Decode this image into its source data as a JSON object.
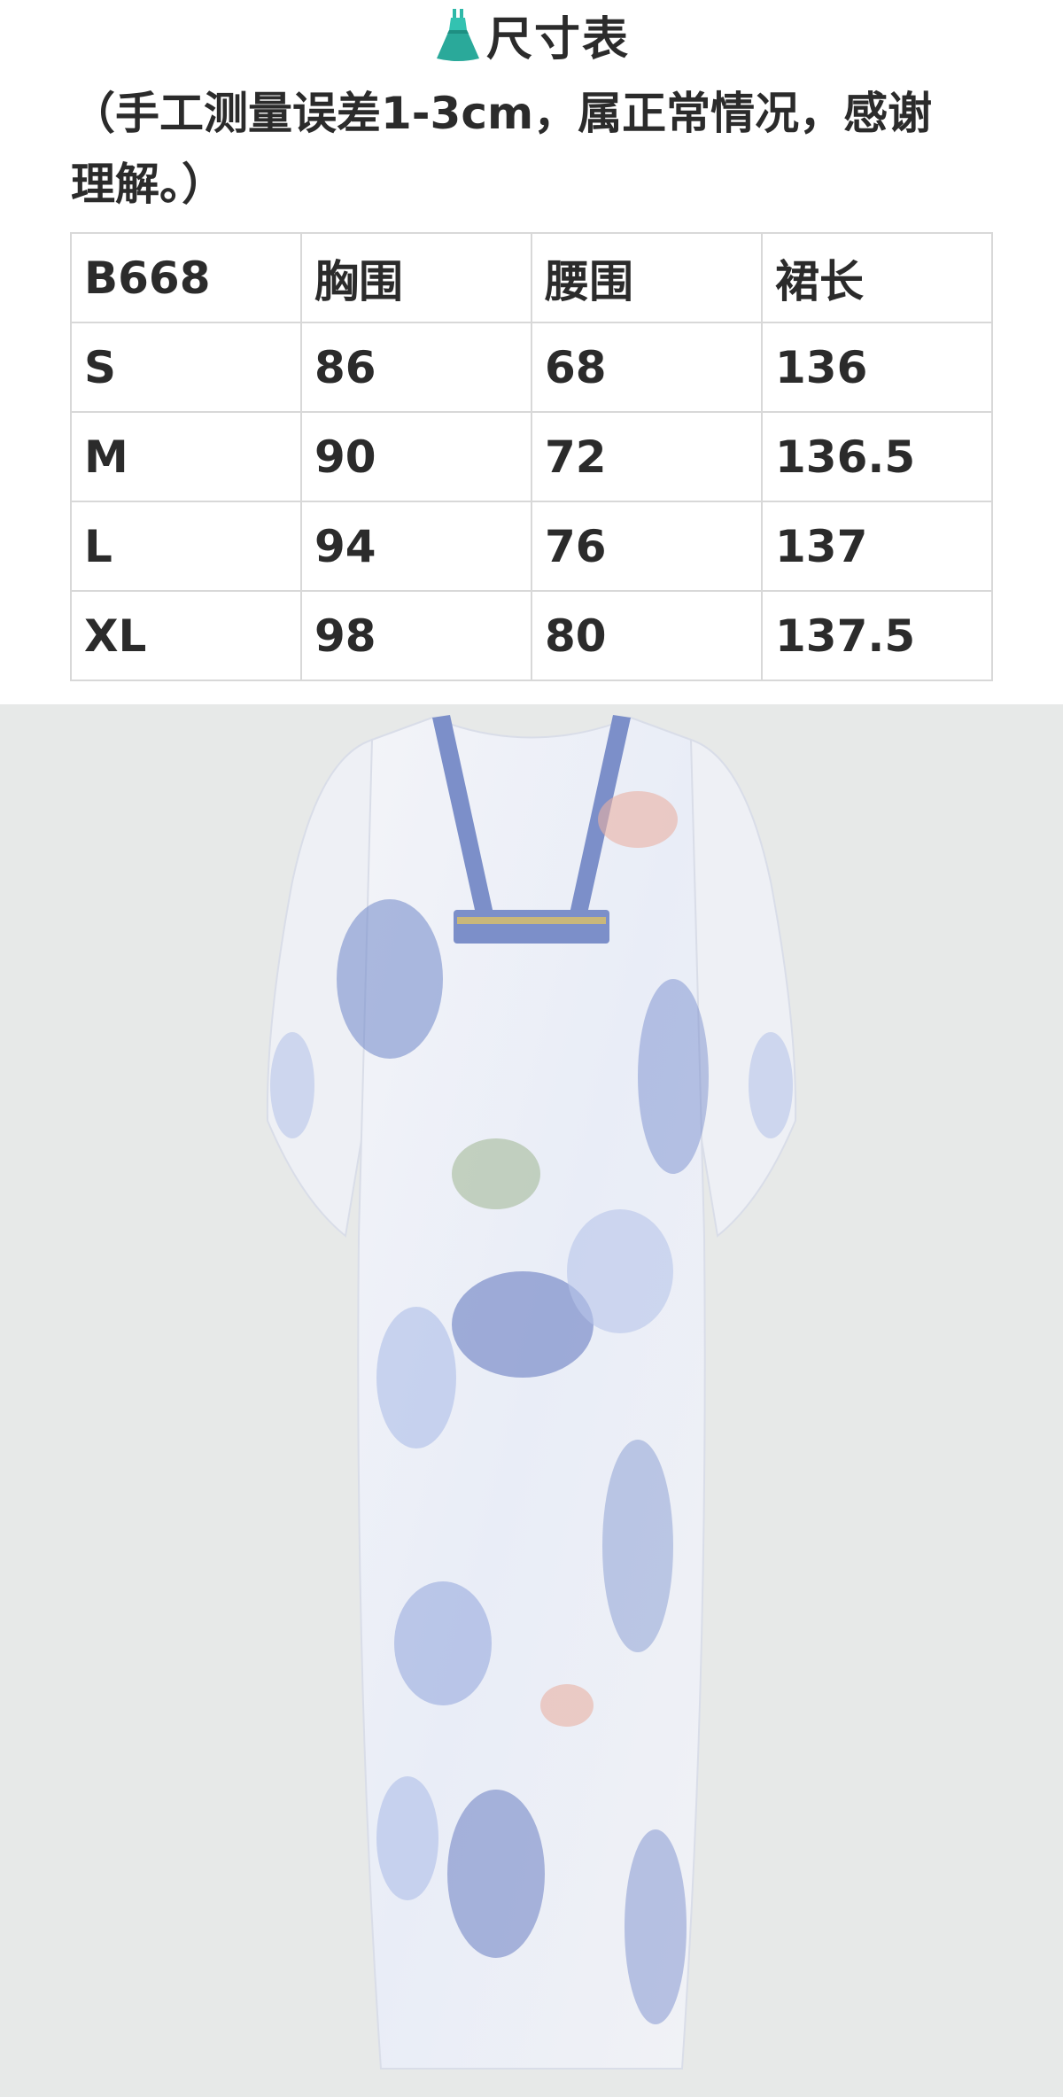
{
  "header": {
    "icon": "dress-icon",
    "title": "尺寸表"
  },
  "note": "（手工测量误差1-3cm，属正常情况，感谢理解。）",
  "size_table": {
    "headers": [
      "B668",
      "胸围",
      "腰围",
      "裙长"
    ],
    "rows": [
      [
        "S",
        "86",
        "68",
        "136"
      ],
      [
        "M",
        "90",
        "72",
        "136.5"
      ],
      [
        "L",
        "94",
        "76",
        "137"
      ],
      [
        "XL",
        "98",
        "80",
        "137.5"
      ]
    ]
  },
  "product_image": {
    "subject": "floral-print-kaftan-dress",
    "colors": {
      "background": "#e7e9e8",
      "fabric": "#f2f3f6",
      "blue_print": "#6f86c9",
      "light_blue": "#b7c4ea",
      "pink_flower": "#eab0a4",
      "leaf_green": "#8fa87a"
    }
  }
}
